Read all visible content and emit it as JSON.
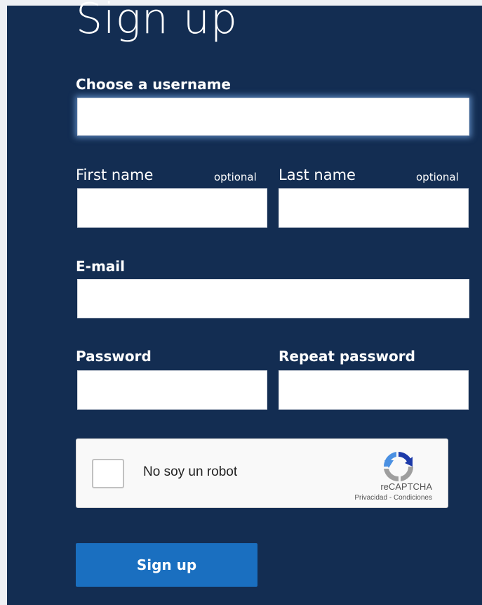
{
  "form": {
    "title": "Sign up",
    "username_label": "Choose a username",
    "username_value": "",
    "first_name_label": "First name",
    "first_name_optional": "optional",
    "first_name_value": "",
    "last_name_label": "Last name",
    "last_name_optional": "optional",
    "last_name_value": "",
    "email_label": "E-mail",
    "email_value": "",
    "password_label": "Password",
    "password_value": "",
    "repeat_password_label": "Repeat password",
    "repeat_password_value": "",
    "submit_label": "Sign up"
  },
  "captcha": {
    "checkbox_label": "No soy un robot",
    "brand": "reCAPTCHA",
    "privacy": "Privacidad",
    "separator": " - ",
    "terms": "Condiciones",
    "checked": false
  },
  "colors": {
    "panel_background": "#132d52",
    "button_background": "#1a6fc0",
    "text": "#ffffff"
  }
}
